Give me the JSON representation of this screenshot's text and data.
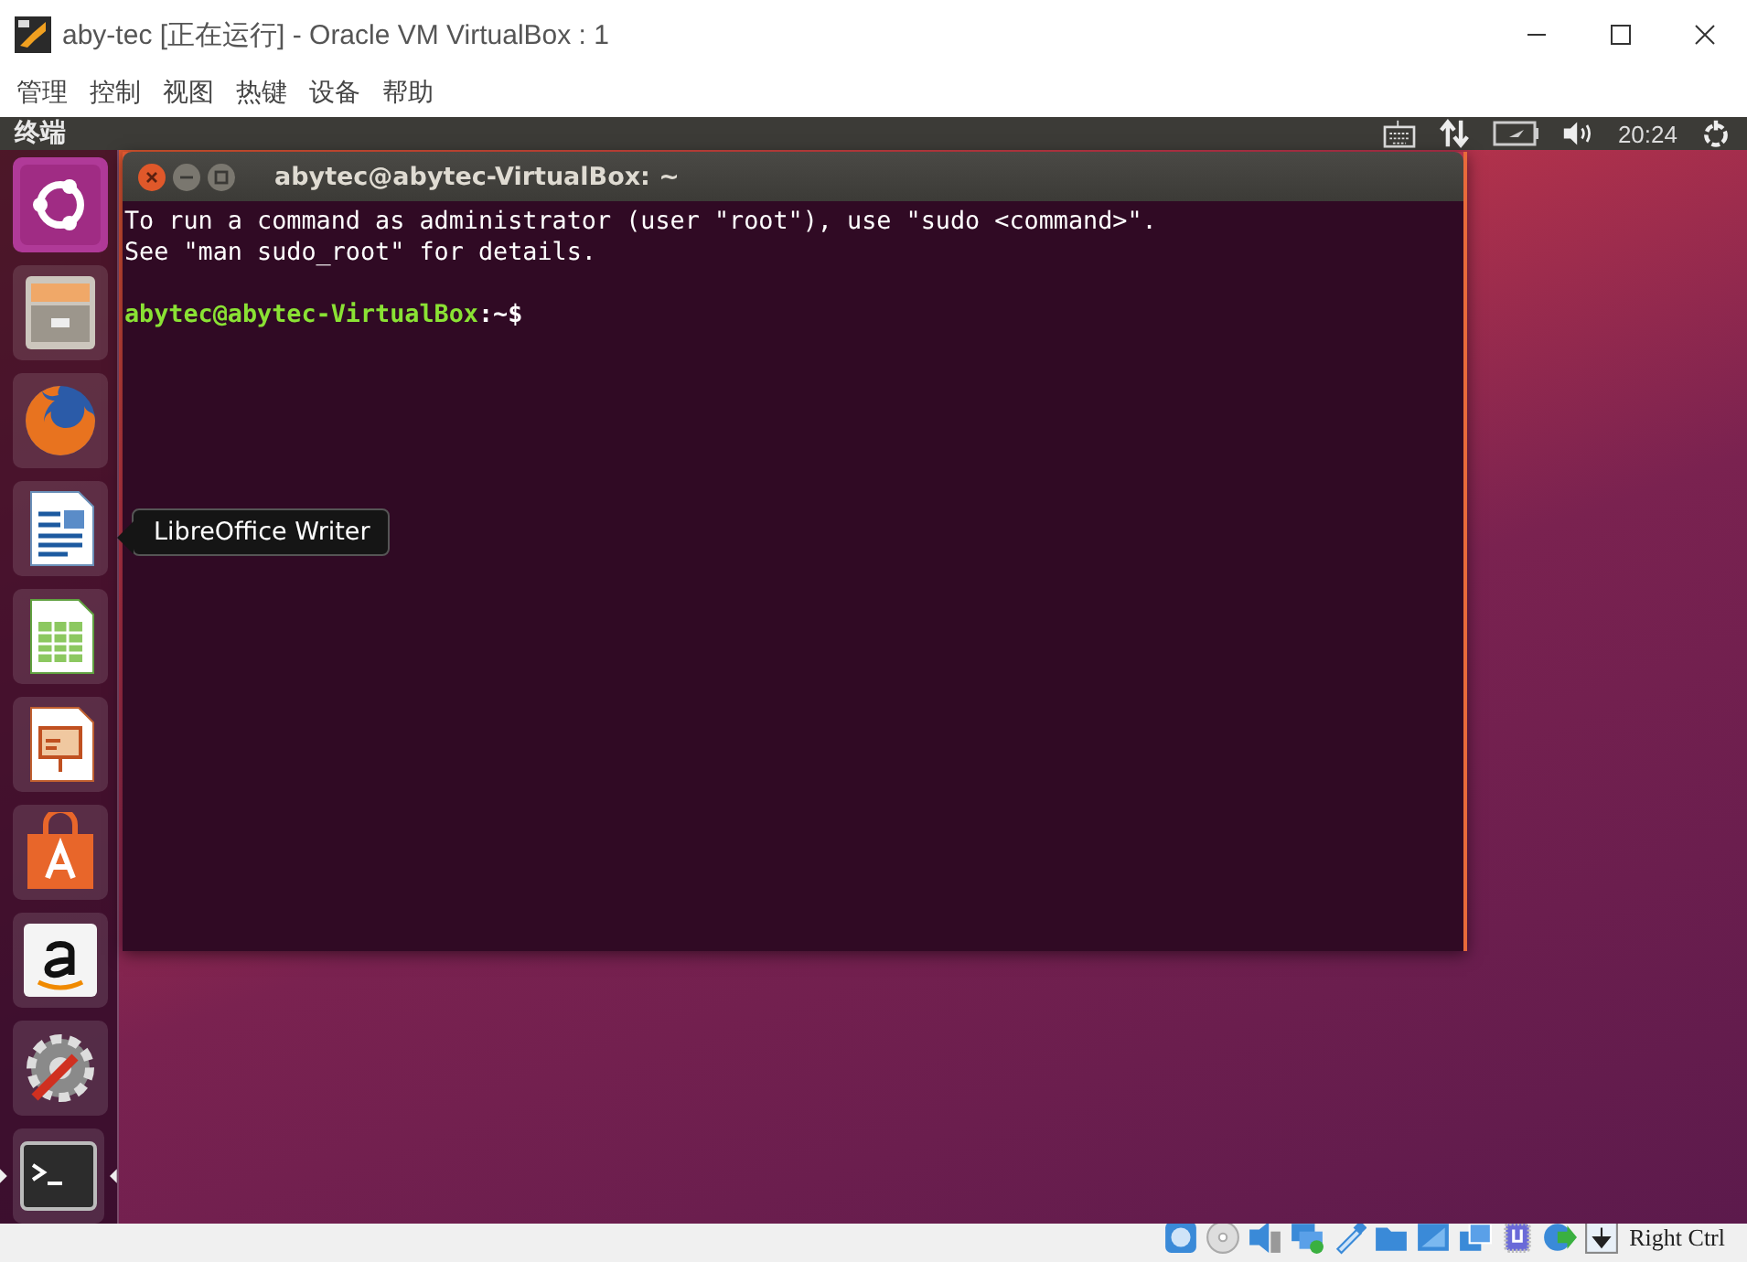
{
  "window": {
    "title": "aby-tec [正在运行] - Oracle VM VirtualBox : 1"
  },
  "menu": [
    "管理",
    "控制",
    "视图",
    "热键",
    "设备",
    "帮助"
  ],
  "top_panel": {
    "app_title": "终端",
    "clock": "20:24"
  },
  "launcher": [
    {
      "kind": "ubuntu",
      "running": false,
      "selected": true
    },
    {
      "kind": "files",
      "running": false,
      "selected": false
    },
    {
      "kind": "firefox",
      "running": false,
      "selected": false
    },
    {
      "kind": "writer",
      "running": false,
      "selected": false
    },
    {
      "kind": "calc",
      "running": false,
      "selected": false
    },
    {
      "kind": "impress",
      "running": false,
      "selected": false
    },
    {
      "kind": "software",
      "running": false,
      "selected": false
    },
    {
      "kind": "amazon",
      "running": false,
      "selected": false
    },
    {
      "kind": "settings",
      "running": false,
      "selected": false
    },
    {
      "kind": "terminal",
      "running": true,
      "selected": false
    }
  ],
  "tooltip": "LibreOffice Writer",
  "terminal": {
    "title": "abytec@abytec-VirtualBox: ~",
    "lines": [
      {
        "kind": "output",
        "text": "To run a command as administrator (user \"root\"), use \"sudo <command>\"."
      },
      {
        "kind": "output",
        "text": "See \"man sudo_root\" for details."
      },
      {
        "kind": "blank"
      },
      {
        "kind": "prompt",
        "user": "abytec@abytec-VirtualBox",
        "path": ":~$"
      }
    ]
  },
  "status_bar": {
    "host_key": "Right Ctrl"
  }
}
